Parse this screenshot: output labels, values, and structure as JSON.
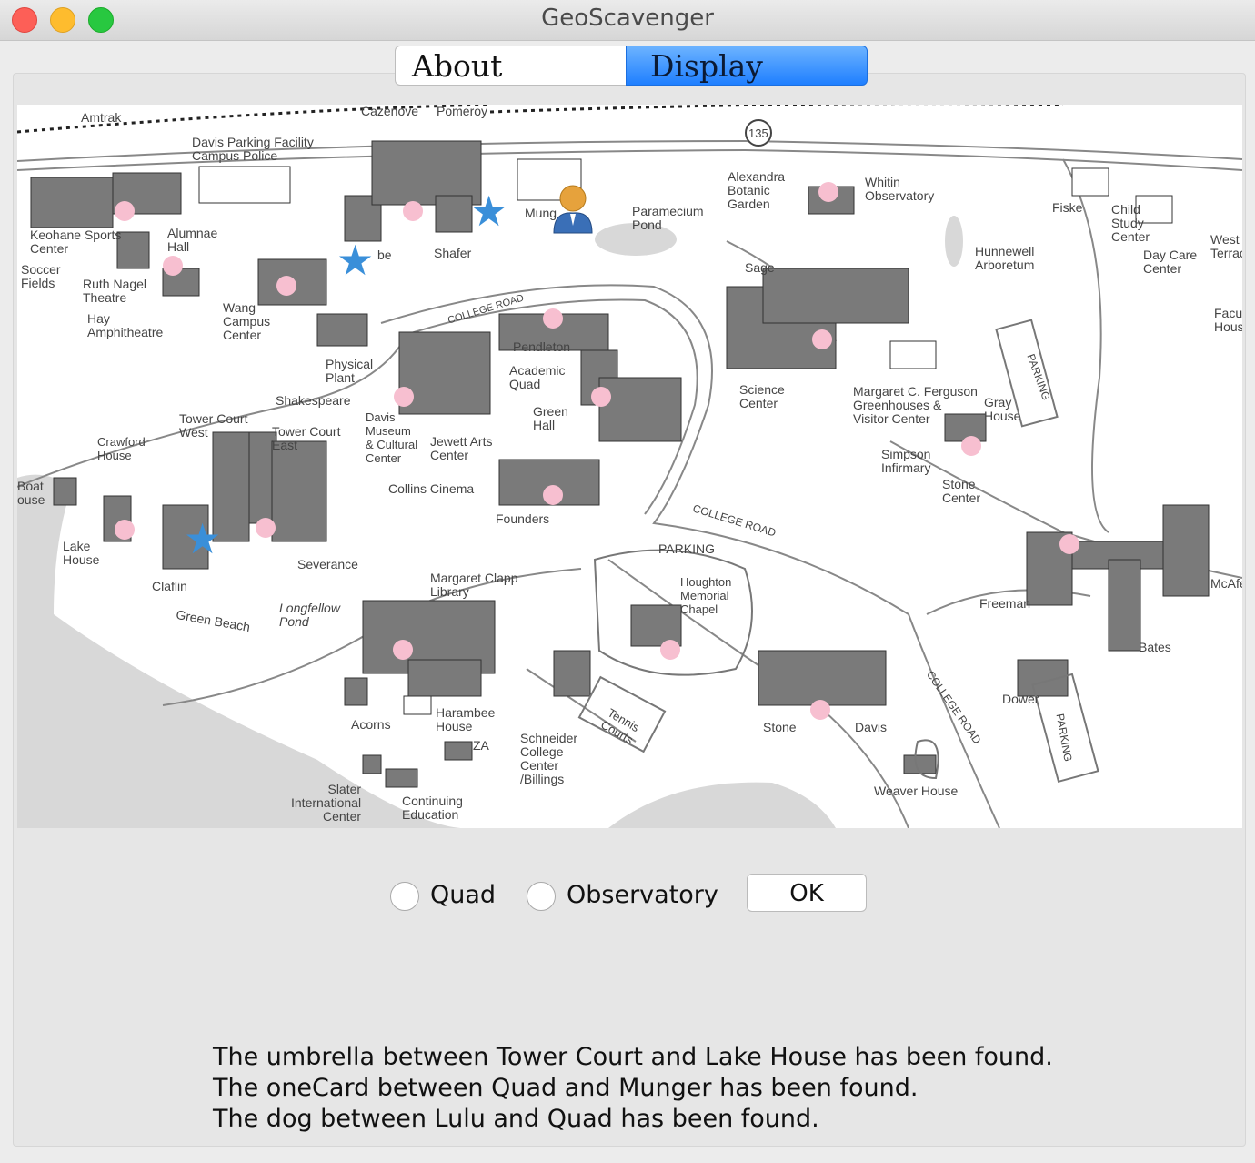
{
  "window": {
    "title": "GeoScavenger"
  },
  "tabs": [
    {
      "label": "About",
      "selected": false
    },
    {
      "label": "Display",
      "selected": true
    }
  ],
  "map": {
    "labels": {
      "amtrak": "Amtrak",
      "cazenove": "Cazenove",
      "pomeroy": "Pomeroy",
      "route": "135",
      "davis_parking": "Davis Parking Facility\nCampus Police",
      "keohane": "Keohane Sports\nCenter",
      "soccer": "Soccer\nFields",
      "alumnae": "Alumnae\nHall",
      "ruth_nagel": "Ruth Nagel\nTheatre",
      "hay": "Hay\nAmphitheatre",
      "wang": "Wang\nCampus\nCenter",
      "beebe": "be",
      "shafer": "Shafer",
      "munger": "Mung",
      "paramecium": "Paramecium\nPond",
      "alexandra": "Alexandra\nBotanic\nGarden",
      "whitin": "Whitin\nObservatory",
      "hunnewell": "Hunnewell\nArboretum",
      "fiske": "Fiske",
      "child_study": "Child\nStudy\nCenter",
      "day_care": "Day Care\nCenter",
      "west_terrace": "West\nTerrac",
      "faculty": "Facu\nHous",
      "sage": "Sage",
      "physical_plant": "Physical\nPlant",
      "college_road_1": "COLLEGE ROAD",
      "pendleton": "Pendleton",
      "academic_quad": "Academic\nQuad",
      "green_hall": "Green\nHall",
      "science_center": "Science\nCenter",
      "ferguson": "Margaret C. Ferguson\nGreenhouses &\nVisitor Center",
      "gray_house": "Gray\nHouse",
      "parking_right": "PARKING",
      "shakespeare": "Shakespeare",
      "davis_museum": "Davis\nMuseum\n& Cultural\nCenter",
      "jewett": "Jewett Arts\nCenter",
      "tower_court_west": "Tower Court\nWest",
      "tower_court_east": "Tower Court\nEast",
      "crawford": "Crawford\nHouse",
      "simpson": "Simpson\nInfirmary",
      "stone_center": "Stone\nCenter",
      "boat_house": "Boat\nouse",
      "collins": "Collins Cinema",
      "founders": "Founders",
      "college_road_2": "COLLEGE ROAD",
      "parking_mid": "PARKING",
      "lake_house": "Lake\nHouse",
      "claflin": "Claflin",
      "severance": "Severance",
      "clapp": "Margaret Clapp\nLibrary",
      "houghton": "Houghton\nMemorial\nChapel",
      "freeman": "Freeman",
      "mcafee": "McAfe",
      "longfellow": "Longfellow\nPond",
      "green_beach": "Green Beach",
      "bates": "Bates",
      "tennis": "Tennis\nCourts",
      "dower": "Dower",
      "stone": "Stone",
      "davis": "Davis",
      "college_road_3": "COLLEGE ROAD",
      "parking_low": "PARKING",
      "acorns": "Acorns",
      "harambee": "Harambee\nHouse",
      "za": "ZA",
      "schneider": "Schneider\nCollege\nCenter\n/Billings",
      "weaver": "Weaver House",
      "slater": "Slater\nInternational\nCenter",
      "continuing": "Continuing\nEducation"
    },
    "markers": {
      "pink_dot_color": "#f7bfd0",
      "star_color": "#3a8fd9",
      "person_icon": "person-marker-icon"
    }
  },
  "controls": {
    "radio_quad_label": "Quad",
    "radio_observatory_label": "Observatory",
    "ok_label": "OK"
  },
  "messages": [
    "The umbrella between Tower Court and Lake House has been found.",
    "The oneCard between Quad and Munger has been found.",
    "The dog between Lulu and Quad has been found."
  ]
}
